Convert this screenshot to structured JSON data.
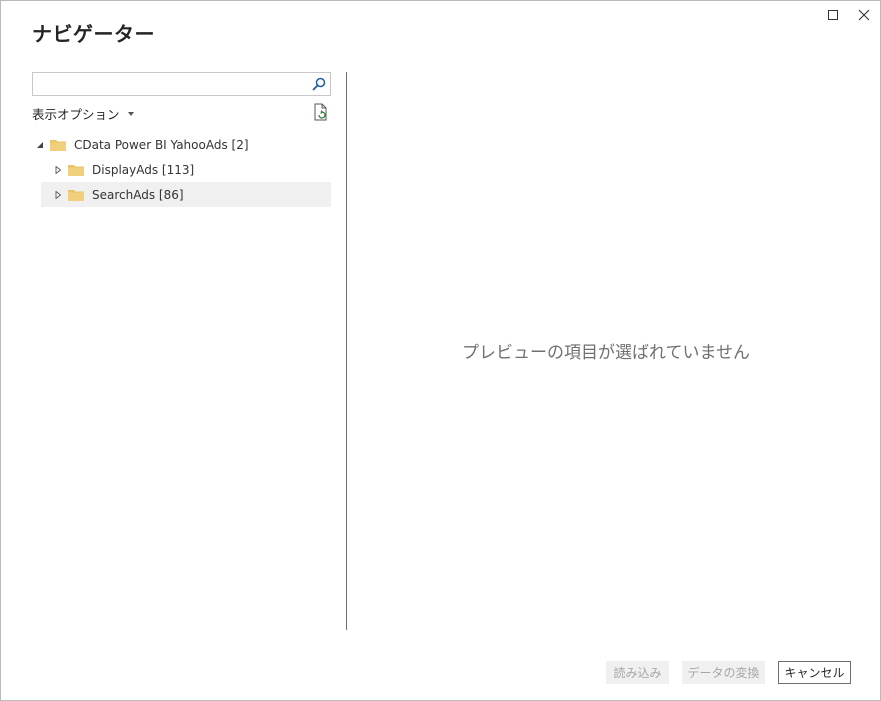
{
  "window": {
    "title": "ナビゲーター",
    "controls": {
      "maximize_icon": "maximize-icon",
      "close_icon": "close-icon"
    }
  },
  "search": {
    "value": "",
    "placeholder": "",
    "icon": "search-icon"
  },
  "options": {
    "label": "表示オプション",
    "refresh_icon": "refresh-icon"
  },
  "tree": {
    "root": {
      "label": "CData Power BI YahooAds [2]",
      "expanded": true
    },
    "children": [
      {
        "label": "DisplayAds [113]",
        "expanded": false,
        "selected": false
      },
      {
        "label": "SearchAds [86]",
        "expanded": false,
        "selected": true
      }
    ]
  },
  "preview": {
    "empty_message": "プレビューの項目が選ばれていません"
  },
  "footer": {
    "load_label": "読み込み",
    "transform_label": "データの変換",
    "cancel_label": "キャンセル"
  },
  "colors": {
    "folder": "#e9c46a",
    "divider": "#6d6d6d",
    "selected_row": "#f0f0f0"
  }
}
